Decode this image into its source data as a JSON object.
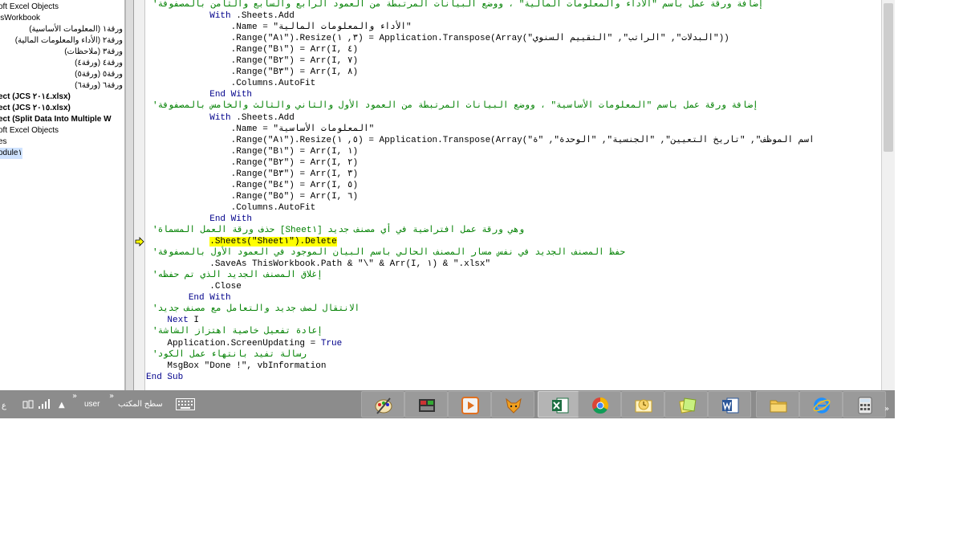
{
  "project_explorer": {
    "items": [
      {
        "label": "oft Excel Objects",
        "bold": false
      },
      {
        "label": "isWorkbook",
        "bold": false
      },
      {
        "label": "ورقة١ (المعلومات الأساسية)",
        "bold": false
      },
      {
        "label": "ورقة٢ (الأداء والمعلومات المالية)",
        "bold": false
      },
      {
        "label": "ورقة٣ (ملاحظات)",
        "bold": false
      },
      {
        "label": "ورقة٤ (ورقة٤)",
        "bold": false
      },
      {
        "label": "ورقة٥ (ورقة٥)",
        "bold": false
      },
      {
        "label": "ورقة٦ (ورقة٦)",
        "bold": false
      },
      {
        "label": "ect (JCS ٢٠١٤.xlsx)",
        "bold": true
      },
      {
        "label": "ect (JCS ٢٠١٥.xlsx)",
        "bold": true
      },
      {
        "label": "ect (Split Data Into Multiple W",
        "bold": true
      },
      {
        "label": "oft Excel Objects",
        "bold": false
      },
      {
        "label": "es",
        "bold": false
      },
      {
        "label": "odule١",
        "bold": false
      }
    ]
  },
  "code_lines": [
    {
      "type": "comment",
      "text": "'إضافة ورقة عمل باسم \"الأداء والمعلومات المالية\" ، ووضع البيانات المرتبطة من العمود الرابع والسابع والثامن بالمصفوفة"
    },
    {
      "type": "code",
      "indent": "            ",
      "kw": "With",
      "text": " .Sheets.Add"
    },
    {
      "type": "code",
      "indent": "                ",
      "kw": "",
      "text": ".Name = \"الأداء والمعلومات المالية\""
    },
    {
      "type": "code",
      "indent": "                ",
      "kw": "",
      "text": ".Range(\"A١\").Resize(٣, ١) = Application.Transpose(Array(\"البدلات\", \"الراتب\", \"التقييم السنوي\"))"
    },
    {
      "type": "code",
      "indent": "                ",
      "kw": "",
      "text": ".Range(\"B١\") = Arr(I, ٤)"
    },
    {
      "type": "code",
      "indent": "                ",
      "kw": "",
      "text": ".Range(\"B٢\") = Arr(I, ٧)"
    },
    {
      "type": "code",
      "indent": "                ",
      "kw": "",
      "text": ".Range(\"B٣\") = Arr(I, ٨)"
    },
    {
      "type": "code",
      "indent": "                ",
      "kw": "",
      "text": ".Columns.AutoFit"
    },
    {
      "type": "code",
      "indent": "            ",
      "kw": "End With",
      "text": ""
    },
    {
      "type": "comment",
      "text": "'إضافة ورقة عمل باسم \"المعلومات الأساسية\" ، ووضع البيانات المرتبطة من العمود الأول والثاني والثالث والخامس بالمصفوفة"
    },
    {
      "type": "code",
      "indent": "            ",
      "kw": "With",
      "text": " .Sheets.Add"
    },
    {
      "type": "code",
      "indent": "                ",
      "kw": "",
      "text": ".Name = \"المعلومات الأساسية\""
    },
    {
      "type": "code",
      "indent": "                ",
      "kw": "",
      "text": ".Range(\"A١\").Resize(٥, ١) = Application.Transpose(Array(\"اسم الموظف\", \"تاريخ التعيين\", \"الجنسية\", \"الوحدة\", \"ة"
    },
    {
      "type": "code",
      "indent": "                ",
      "kw": "",
      "text": ".Range(\"B١\") = Arr(I, ١)"
    },
    {
      "type": "code",
      "indent": "                ",
      "kw": "",
      "text": ".Range(\"B٢\") = Arr(I, ٢)"
    },
    {
      "type": "code",
      "indent": "                ",
      "kw": "",
      "text": ".Range(\"B٣\") = Arr(I, ٣)"
    },
    {
      "type": "code",
      "indent": "                ",
      "kw": "",
      "text": ".Range(\"B٤\") = Arr(I, ٥)"
    },
    {
      "type": "code",
      "indent": "                ",
      "kw": "",
      "text": ".Range(\"B٥\") = Arr(I, ٦)"
    },
    {
      "type": "code",
      "indent": "                ",
      "kw": "",
      "text": ".Columns.AutoFit"
    },
    {
      "type": "code",
      "indent": "            ",
      "kw": "End With",
      "text": ""
    },
    {
      "type": "comment",
      "text": "'حذف ورقة العمل المسماة [Sheet١] وهي ورقة عمل افتراضية في أي مصنف جديد"
    },
    {
      "type": "highlight",
      "indent": "            ",
      "text": ".Sheets(\"Sheet١\").Delete"
    },
    {
      "type": "comment",
      "text": "'حفظ المصنف الجديد في نفس مسار المصنف الحالي باسم البيان الموجود في العمود الأول بالمصفوفة"
    },
    {
      "type": "code",
      "indent": "            ",
      "kw": "",
      "text": ".SaveAs ThisWorkbook.Path & \"\\\" & Arr(I, ١) & \".xlsx\""
    },
    {
      "type": "comment",
      "text": "'إغلاق المصنف الجديد الذي تم حفظه"
    },
    {
      "type": "code",
      "indent": "            ",
      "kw": "",
      "text": ".Close"
    },
    {
      "type": "code",
      "indent": "        ",
      "kw": "End With",
      "text": ""
    },
    {
      "type": "comment",
      "text": "'الانتقال لصف جديد والتعامل مع مصنف جديد"
    },
    {
      "type": "code",
      "indent": "    ",
      "kw": "Next",
      "text": " I"
    },
    {
      "type": "comment",
      "text": "'إعادة تفعيل خاصية اهتزاز الشاشة"
    },
    {
      "type": "code",
      "indent": "    ",
      "kw": "",
      "text": "Application.ScreenUpdating = ",
      "kw2": "True"
    },
    {
      "type": "comment",
      "text": "'رسالة تفيد بانتهاء عمل الكود"
    },
    {
      "type": "code",
      "indent": "    ",
      "kw": "",
      "text": "MsgBox \"Done !\", vbInformation"
    },
    {
      "type": "code",
      "indent": "",
      "kw": "End Sub",
      "text": ""
    }
  ],
  "taskbar": {
    "tray": {
      "clock_fragment": "ع",
      "chevron": "»",
      "user_label": "user",
      "desktop_label": "سطح المكتب",
      "up_arrow": "▲"
    },
    "apps": [
      {
        "name": "paint-app-icon",
        "active": false
      },
      {
        "name": "video-editor-icon",
        "active": false
      },
      {
        "name": "media-player-icon",
        "active": false
      },
      {
        "name": "fox-app-icon",
        "active": false
      },
      {
        "name": "excel-icon",
        "active": true
      },
      {
        "name": "chrome-icon",
        "active": false
      },
      {
        "name": "outlook-icon",
        "active": false
      },
      {
        "name": "sticky-notes-icon",
        "active": false
      },
      {
        "name": "word-icon",
        "active": false
      },
      {
        "name": "file-explorer-icon",
        "active": false
      },
      {
        "name": "internet-explorer-icon",
        "active": false
      },
      {
        "name": "calculator-icon",
        "active": false
      }
    ],
    "overflow": "»"
  },
  "colors": {
    "comment": "#008000",
    "keyword": "#00008b",
    "highlight": "#ffff00",
    "taskbar": "#8c8c8c"
  }
}
